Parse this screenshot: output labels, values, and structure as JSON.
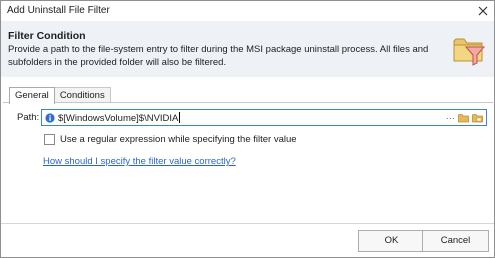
{
  "window": {
    "title": "Add Uninstall File Filter",
    "close_icon": "close-icon"
  },
  "header": {
    "title": "Filter Condition",
    "description": "Provide a path to the file-system entry to filter during the MSI package uninstall process. All files and subfolders in the provided folder will also be filtered.",
    "icon": "folder-filter-icon"
  },
  "tabs": [
    {
      "label": "General",
      "active": true
    },
    {
      "label": "Conditions",
      "active": false
    }
  ],
  "form": {
    "path_label": "Path:",
    "path_value": "$[WindowsVolume]$\\NVIDIA",
    "browse_ellipsis": "…",
    "regex_checkbox_label": "Use a regular expression while specifying the filter value",
    "regex_checked": false,
    "help_link": "How should I specify the filter value correctly?"
  },
  "buttons": {
    "ok": "OK",
    "cancel": "Cancel"
  },
  "colors": {
    "accent": "#3c82d6",
    "link": "#2a66c8",
    "header_bg": "#eef2f7"
  }
}
